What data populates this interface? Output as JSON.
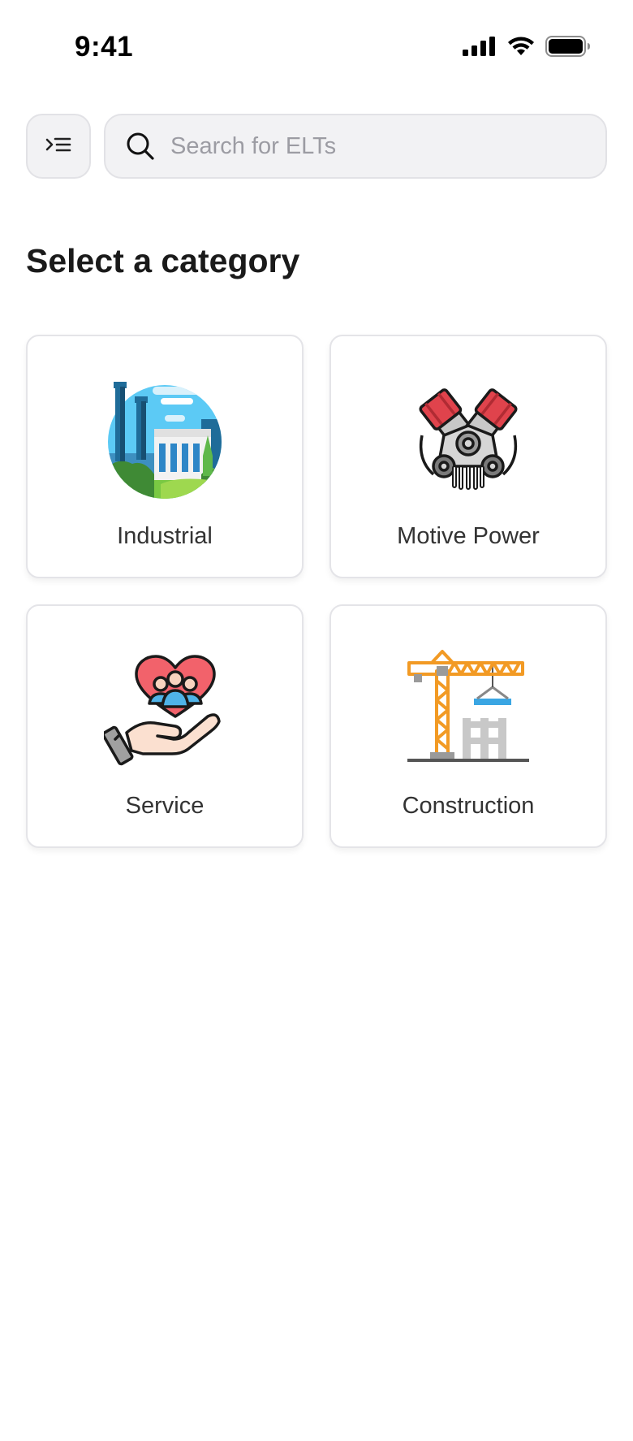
{
  "status_bar": {
    "time": "9:41",
    "icons": [
      "signal-icon",
      "wifi-icon",
      "battery-icon"
    ]
  },
  "search": {
    "placeholder": "Search for ELTs",
    "value": ""
  },
  "menu": {
    "icon": "menu-indent-icon"
  },
  "page": {
    "heading": "Select a category"
  },
  "categories": [
    {
      "label": "Industrial",
      "icon": "industrial-factory-icon"
    },
    {
      "label": "Motive Power",
      "icon": "engine-icon"
    },
    {
      "label": "Service",
      "icon": "heart-hand-service-icon"
    },
    {
      "label": "Construction",
      "icon": "construction-crane-icon"
    }
  ],
  "colors": {
    "background": "#ffffff",
    "field_background": "#f2f2f4",
    "border": "#e2e2e6",
    "placeholder": "#9c9ca3",
    "heading": "#1a1a1a"
  }
}
